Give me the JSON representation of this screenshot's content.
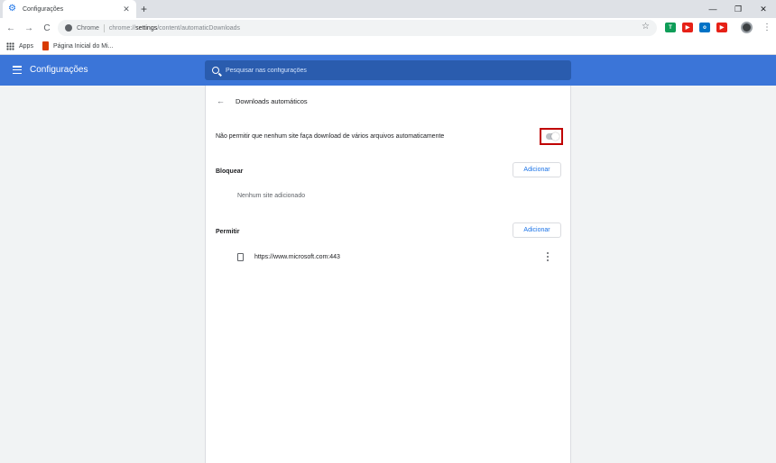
{
  "browser": {
    "tab": {
      "title": "Configurações",
      "close": "✕"
    },
    "new_tab": "+",
    "window_controls": {
      "minimize": "—",
      "restore": "❐",
      "close": "✕"
    },
    "nav": {
      "back": "←",
      "forward": "→",
      "reload": "C"
    },
    "omnibox": {
      "origin": "Chrome",
      "url_prefix": "chrome://",
      "url_host": "settings",
      "url_path": "/content/automaticDownloads"
    },
    "star": "☆",
    "menu": "⋮",
    "extensions": [
      {
        "name": "google-translate-icon",
        "label": "T",
        "color": "#0f9d58"
      },
      {
        "name": "youtube-icon",
        "label": "▶",
        "color": "#e62117"
      },
      {
        "name": "outlook-icon",
        "label": "o",
        "color": "#0072c6"
      },
      {
        "name": "youtube-icon-2",
        "label": "▶",
        "color": "#e62117"
      }
    ]
  },
  "bookmarks": [
    {
      "label": "Apps"
    },
    {
      "label": "Página Inicial do Mi..."
    }
  ],
  "settings": {
    "header_title": "Configurações",
    "search_placeholder": "Pesquisar nas configurações",
    "accent_color": "#3b75d8"
  },
  "page": {
    "back": "←",
    "title": "Downloads automáticos",
    "toggle_label": "Não permitir que nenhum site faça download de vários arquivos automaticamente",
    "toggle_on": false,
    "block": {
      "label": "Bloquear",
      "add_button": "Adicionar",
      "empty": "Nenhum site adicionado"
    },
    "allow": {
      "label": "Permitir",
      "add_button": "Adicionar",
      "sites": [
        "https://www.microsoft.com:443"
      ]
    }
  }
}
